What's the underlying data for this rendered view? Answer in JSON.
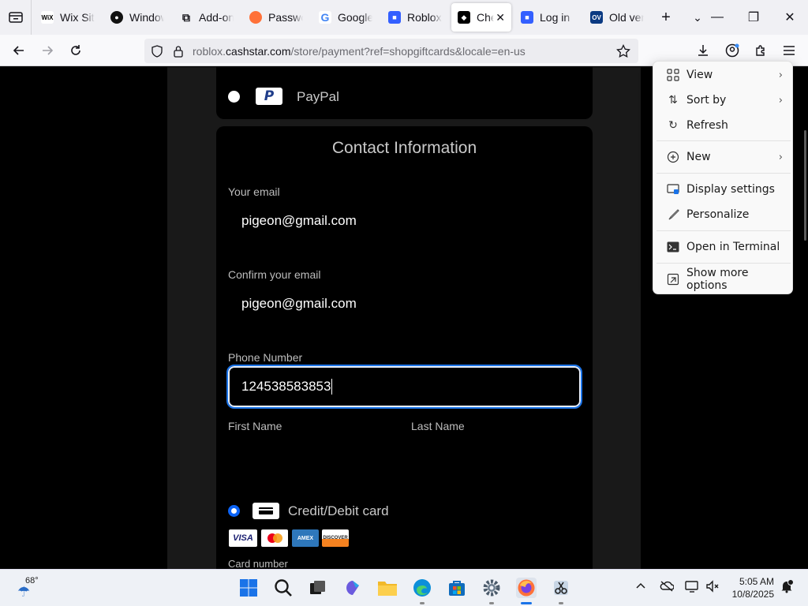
{
  "browser": {
    "tabs": [
      {
        "title": "Wix Site",
        "icon": "wix-icon",
        "color": "#000000"
      },
      {
        "title": "Windows",
        "icon": "github-icon",
        "color": "#000000"
      },
      {
        "title": "Add-ons",
        "icon": "puzzle-icon",
        "color": "#000000"
      },
      {
        "title": "Passwords",
        "icon": "firefox-icon",
        "color": "#ff7139"
      },
      {
        "title": "Google",
        "icon": "google-icon",
        "color": "#4285f4"
      },
      {
        "title": "Roblox",
        "icon": "roblox-icon",
        "color": "#335fff"
      },
      {
        "title": "Checkout",
        "icon": "roblox-icon",
        "color": "#000000",
        "active": true
      },
      {
        "title": "Log in",
        "icon": "roblox-icon",
        "color": "#335fff"
      },
      {
        "title": "Old version",
        "icon": "ov-icon",
        "color": "#0b3a82"
      }
    ],
    "url_prefix": "roblox.",
    "url_domain": "cashstar.com",
    "url_path": "/store/payment?ref=shopgiftcards&locale=en-us"
  },
  "page": {
    "paypal_label": "PayPal",
    "contact_title": "Contact Information",
    "email_label": "Your email",
    "email_value": "pigeon@gmail.com",
    "confirm_email_label": "Confirm your email",
    "confirm_email_value": "pigeon@gmail.com",
    "phone_label": "Phone Number",
    "phone_value": "124538583853",
    "first_name_label": "First Name",
    "last_name_label": "Last Name",
    "credit_label": "Credit/Debit card",
    "card_number_label": "Card number",
    "card_logos": [
      "VISA",
      "mastercard",
      "AMEX",
      "DISCOVER"
    ]
  },
  "context_menu": {
    "items": [
      {
        "label": "View",
        "icon": "view-grid-icon",
        "submenu": true
      },
      {
        "label": "Sort by",
        "icon": "sort-icon",
        "submenu": true
      },
      {
        "label": "Refresh",
        "icon": "refresh-icon",
        "submenu": false
      },
      {
        "label": "New",
        "icon": "new-plus-icon",
        "submenu": true
      },
      {
        "label": "Display settings",
        "icon": "display-icon",
        "submenu": false
      },
      {
        "label": "Personalize",
        "icon": "brush-icon",
        "submenu": false
      },
      {
        "label": "Open in Terminal",
        "icon": "terminal-icon",
        "submenu": false
      },
      {
        "label": "Show more options",
        "icon": "more-options-icon",
        "submenu": false
      }
    ]
  },
  "taskbar": {
    "weather_temp": "68°",
    "time": "5:05 AM",
    "date": "10/8/2025"
  },
  "colors": {
    "accent": "#0b63f6",
    "page_bg": "#000000",
    "panel_bg": "#191919"
  }
}
